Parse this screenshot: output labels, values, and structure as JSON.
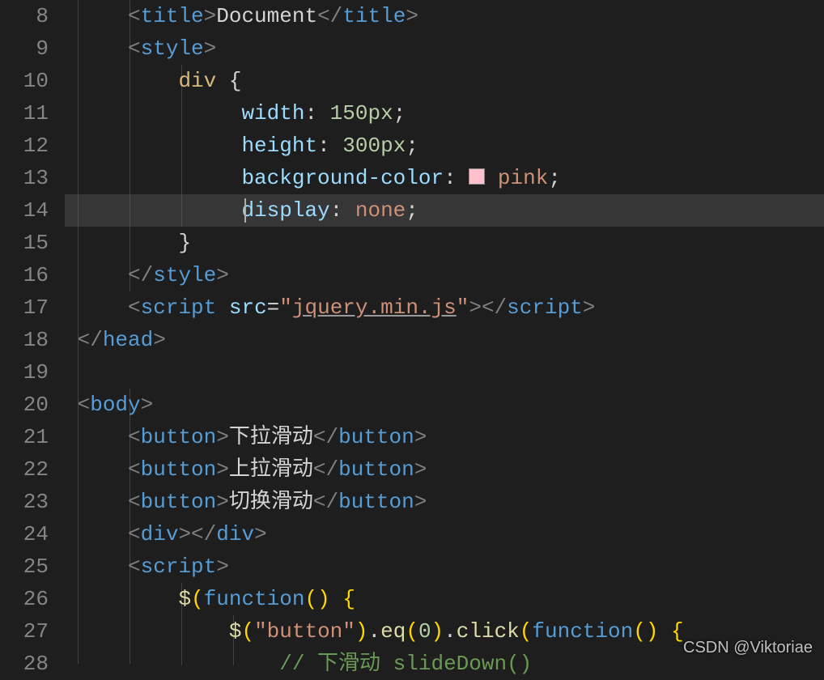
{
  "watermark": "CSDN @Viktoriae",
  "lineNumbers": [
    "8",
    "9",
    "10",
    "11",
    "12",
    "13",
    "14",
    "15",
    "16",
    "17",
    "18",
    "19",
    "20",
    "21",
    "22",
    "23",
    "24",
    "25",
    "26",
    "27",
    "28"
  ],
  "activeLine": 14,
  "code": {
    "l8": {
      "tag_title": "title",
      "text": "Document"
    },
    "l9": {
      "tag": "style"
    },
    "l10": {
      "selector": "div",
      "brace": "{"
    },
    "l11": {
      "prop": "width",
      "num": "150",
      "unit": "px"
    },
    "l12": {
      "prop": "height",
      "num": "300",
      "unit": "px"
    },
    "l13": {
      "prop": "background-color",
      "val": "pink"
    },
    "l14": {
      "prop": "display",
      "val": "none"
    },
    "l15": {
      "brace": "}"
    },
    "l16": {
      "tag": "style"
    },
    "l17": {
      "tag": "script",
      "attr": "src",
      "val": "jquery.min.js"
    },
    "l18": {
      "tag": "head"
    },
    "l20": {
      "tag": "body"
    },
    "l21": {
      "tag": "button",
      "text": "下拉滑动"
    },
    "l22": {
      "tag": "button",
      "text": "上拉滑动"
    },
    "l23": {
      "tag": "button",
      "text": "切换滑动"
    },
    "l24": {
      "tag": "div"
    },
    "l25": {
      "tag": "script"
    },
    "l26": {
      "jq": "$",
      "kw": "function",
      "p1": "(",
      "p2": ")",
      "b": "{"
    },
    "l27": {
      "jq": "$",
      "str": "\"button\"",
      "m1": "eq",
      "num": "0",
      "m2": "click",
      "kw": "function",
      "b": "{"
    },
    "l28": {
      "comment": "// 下滑动 slideDown()"
    }
  }
}
